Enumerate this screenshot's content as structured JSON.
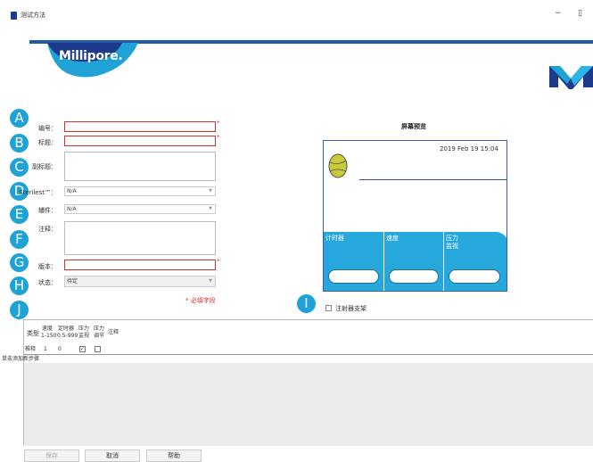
{
  "window": {
    "title": "测试方法",
    "minimize_glyph": "−",
    "maximize_glyph": "▯"
  },
  "brand": {
    "logo_text": "Millipore.",
    "accent_color": "#1e5aa8",
    "wave_color": "#1fa3d6"
  },
  "markers": [
    "A",
    "B",
    "C",
    "D",
    "E",
    "F",
    "G",
    "H",
    "I",
    "J"
  ],
  "form": {
    "number_label": "编号：",
    "title_label": "标题：",
    "subtitle_label": "副标题：",
    "sterilest_label": "Sterilest™：",
    "sterilest_value": "N/A",
    "accessory_label": "辅件：",
    "accessory_value": "N/A",
    "notes_label": "注释：",
    "version_label": "版本：",
    "status_label": "状态：",
    "status_value": "待定",
    "required_star": "*",
    "required_note": "* 必填字段"
  },
  "preview": {
    "title": "屏幕预览",
    "datetime": "2019 Feb 19   15:04",
    "tiles": [
      {
        "label_line1": "计时器",
        "label_line2": ""
      },
      {
        "label_line1": "速度",
        "label_line2": ""
      },
      {
        "label_line1": "压力",
        "label_line2": "监视"
      }
    ]
  },
  "injector_support": {
    "label": "注射器支架",
    "checked": false
  },
  "grid": {
    "columns": [
      {
        "line1": "类型",
        "line2": ""
      },
      {
        "line1": "速度",
        "line2": "1-150"
      },
      {
        "line1": "定时器",
        "line2": "0.5-999"
      },
      {
        "line1": "压力",
        "line2": "监视"
      },
      {
        "line1": "压力",
        "line2": "调节"
      },
      {
        "line1": "注释",
        "line2": ""
      }
    ],
    "rows": [
      {
        "type": "椎释",
        "speed": "1",
        "timer": "0",
        "pressure_monitor": true,
        "pressure_regulate": false,
        "note": ""
      }
    ],
    "add_step_label": "单击添加新步骤",
    "checked_glyph": "✓"
  },
  "footer": {
    "save_label": "保存",
    "cancel_label": "取消",
    "help_label": "帮助"
  }
}
